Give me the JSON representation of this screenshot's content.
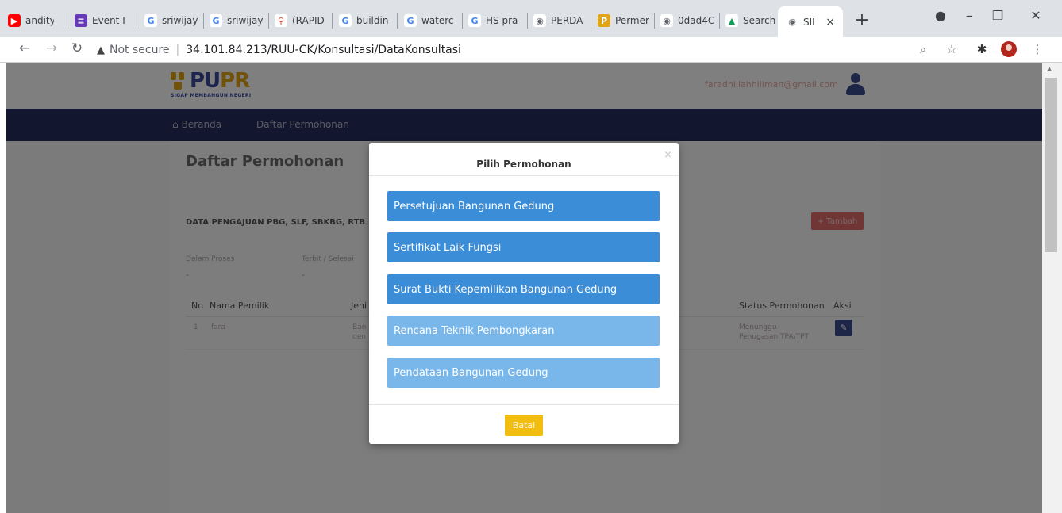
{
  "browser": {
    "tabs": [
      {
        "label": "andity",
        "icon": "youtube-icon",
        "color": "#ff0000",
        "glyph": "▶"
      },
      {
        "label": "Event I",
        "icon": "forms-icon",
        "color": "#673ab7",
        "glyph": "≡"
      },
      {
        "label": "sriwijay",
        "icon": "google-icon",
        "color": "#4285f4",
        "glyph": "G"
      },
      {
        "label": "sriwijay",
        "icon": "google-icon",
        "color": "#4285f4",
        "glyph": "G"
      },
      {
        "label": "(RAPID",
        "icon": "maps-icon",
        "color": "#ea4335",
        "glyph": "⚲"
      },
      {
        "label": "buildin",
        "icon": "google-icon",
        "color": "#4285f4",
        "glyph": "G"
      },
      {
        "label": "waterc",
        "icon": "google-icon",
        "color": "#4285f4",
        "glyph": "G"
      },
      {
        "label": "HS pra",
        "icon": "google-icon",
        "color": "#4285f4",
        "glyph": "G"
      },
      {
        "label": "PERDA",
        "icon": "globe-icon",
        "color": "#5f6368",
        "glyph": "◉"
      },
      {
        "label": "Permer",
        "icon": "pupr-icon",
        "color": "#e0a415",
        "glyph": "P"
      },
      {
        "label": "0dad4C",
        "icon": "globe-icon",
        "color": "#5f6368",
        "glyph": "◉"
      },
      {
        "label": "Search",
        "icon": "drive-icon",
        "color": "#0f9d58",
        "glyph": "▲"
      }
    ],
    "active_tab": {
      "label": "SIN",
      "icon": "globe-icon",
      "glyph": "◉",
      "close": "×"
    },
    "new_tab": "+",
    "url_warning": "▲",
    "not_secure": "Not secure",
    "url": "34.101.84.213/RUU-CK/Konsultasi/DataKonsultasi"
  },
  "header": {
    "logo_text_a": "PU",
    "logo_text_b": "PR",
    "logo_tagline": "SIGAP MEMBANGUN NEGERI",
    "user_email": "faradhillahhillman@gmail.com"
  },
  "nav": {
    "home_label": "Beranda",
    "list_label": "Daftar Permohonan"
  },
  "page": {
    "title": "Daftar Permohonan",
    "data_heading": "DATA PENGAJUAN PBG, SLF, SBKBG, RTB",
    "tambah_label": "Tambah",
    "stats": [
      {
        "label": "Dalam Proses",
        "value": "-"
      },
      {
        "label": "Terbit / Selesai",
        "value": "-"
      }
    ],
    "table": {
      "headers": {
        "no": "No",
        "owner": "Nama Pemilik",
        "type": "Jeni",
        "status": "Status Permohonan",
        "action": "Aksi"
      },
      "rows": [
        {
          "no": "1",
          "owner": "fara",
          "type_1": "Ban",
          "type_2": "den",
          "status_1": "Menunggu",
          "status_2": "Penugasan TPA/TPT"
        }
      ]
    }
  },
  "modal": {
    "title": "Pilih Permohonan",
    "close": "×",
    "options": [
      {
        "label": "Persetujuan Bangunan Gedung",
        "style": "dark"
      },
      {
        "label": "Sertifikat Laik Fungsi",
        "style": "dark"
      },
      {
        "label": "Surat Bukti Kepemilikan Bangunan Gedung",
        "style": "dark"
      },
      {
        "label": "Rencana Teknik Pembongkaran",
        "style": "light"
      },
      {
        "label": "Pendataan Bangunan Gedung",
        "style": "light"
      }
    ],
    "cancel_label": "Batal"
  },
  "colors": {
    "nav_bg": "#242e5e",
    "option_dark": "#3b8dd8",
    "option_light": "#79b6ea",
    "cancel_btn": "#f1bd0f",
    "tambah_btn": "#e06a6a"
  }
}
